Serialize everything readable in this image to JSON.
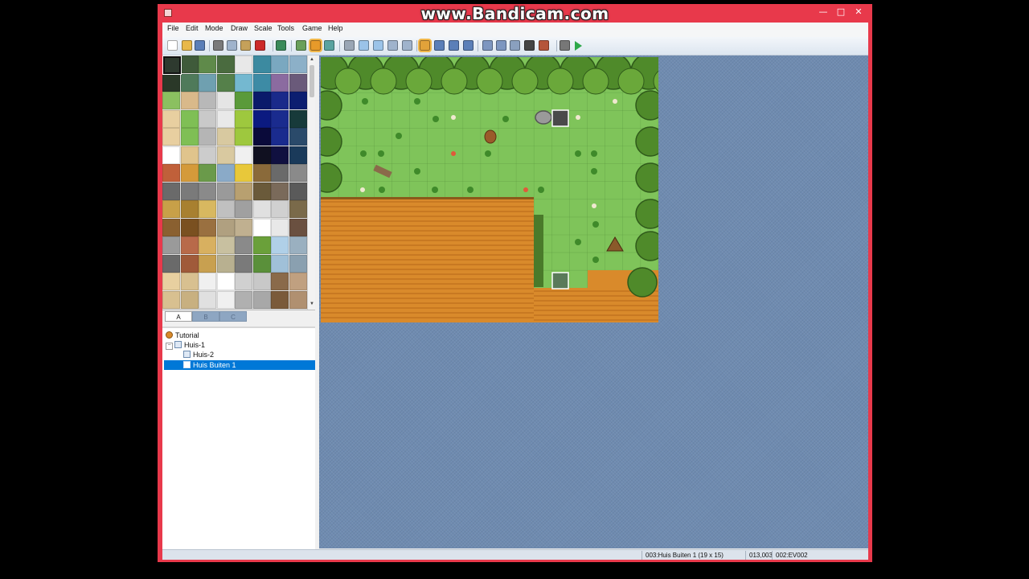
{
  "watermark": "www.Bandicam.com",
  "window_controls": {
    "minimize": "—",
    "maximize": "□",
    "close": "✕"
  },
  "menu": [
    "File",
    "Edit",
    "Mode",
    "Draw",
    "Scale",
    "Tools",
    "Game",
    "Help"
  ],
  "toolbar_icons": [
    "new-project-icon",
    "open-project-icon",
    "save-project-icon",
    "cut-icon",
    "copy-icon",
    "paste-icon",
    "delete-icon",
    "undo-icon",
    "layer-map-icon",
    "event-mode-icon",
    "region-mode-icon",
    "pencil-icon",
    "rectangle-icon",
    "ellipse-icon",
    "flood-fill-icon",
    "shadow-pen-icon",
    "zoom-1-1-icon",
    "zoom-1-2-icon",
    "zoom-1-4-icon",
    "zoom-1-8-icon",
    "database-icon",
    "resource-manager-icon",
    "script-editor-icon",
    "sound-test-icon",
    "character-generator-icon",
    "options-icon",
    "playtest-icon"
  ],
  "tileset_tabs": [
    "A",
    "B",
    "C"
  ],
  "map_tree": [
    {
      "label": "Tutorial",
      "icon": "project-icon"
    },
    {
      "label": "Huis-1",
      "icon": "map-icon"
    },
    {
      "label": "Huis-2",
      "icon": "map-icon"
    },
    {
      "label": "Huis Buiten 1",
      "icon": "map-icon"
    }
  ],
  "status": {
    "map": "003:Huis Buiten 1 (19 x 15)",
    "coords": "013,003",
    "event": "002:EV002"
  },
  "colors": {
    "window_frame": "#e8394b",
    "selection": "#0078d7",
    "map_background": "#6f8bb0"
  }
}
